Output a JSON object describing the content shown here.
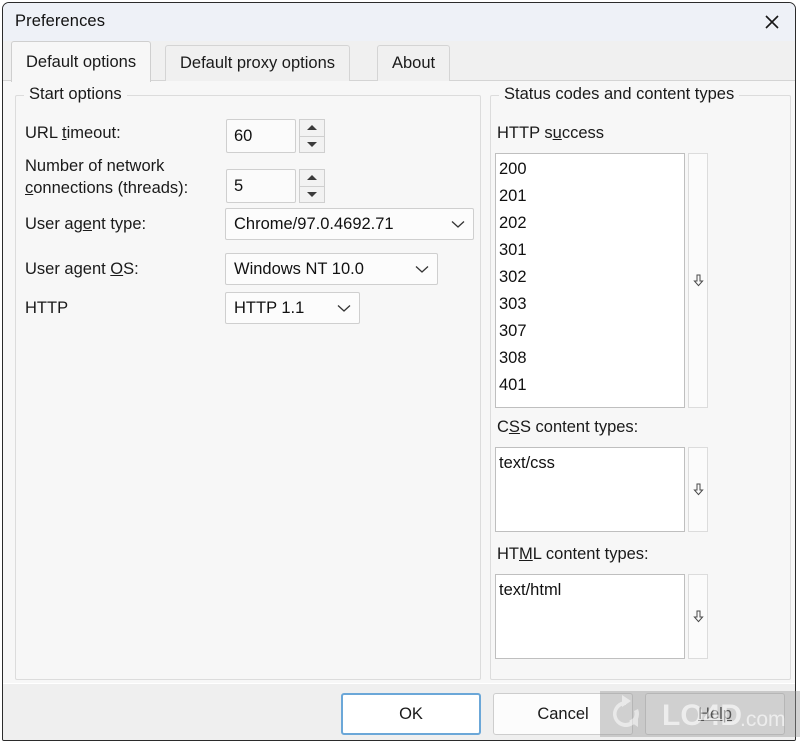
{
  "window": {
    "title": "Preferences",
    "close_icon": "close-icon"
  },
  "tabs": [
    {
      "label": "Default options",
      "selected": true
    },
    {
      "label": "Default proxy options",
      "selected": false
    },
    {
      "label": "About",
      "selected": false
    }
  ],
  "start_options": {
    "legend": "Start options",
    "rows": [
      {
        "label_pre": "URL ",
        "label_mnemonic": "t",
        "label_post": "imeout:",
        "control": "spin",
        "value": "60"
      },
      {
        "label_pre": "Number of network ",
        "label_mnemonic": "c",
        "label_post": "onnections (threads):",
        "control": "spin",
        "value": "5"
      },
      {
        "label_pre": "User ag",
        "label_mnemonic": "e",
        "label_post": "nt type:",
        "control": "combo",
        "value": "Chrome/97.0.4692.71"
      },
      {
        "label_pre": "User agent ",
        "label_mnemonic": "O",
        "label_post": "S:",
        "control": "combo",
        "value": "Windows NT 10.0"
      },
      {
        "label_pre": "HTTP",
        "label_mnemonic": "",
        "label_post": "",
        "control": "combo",
        "value": "HTTP 1.1"
      }
    ]
  },
  "status_options": {
    "legend": "Status codes and content types",
    "http_success": {
      "label_pre": "HTTP s",
      "label_mnemonic": "u",
      "label_post": "ccess",
      "items": [
        "200",
        "201",
        "202",
        "301",
        "302",
        "303",
        "307",
        "308",
        "401"
      ],
      "rail_icon": "down-arrow-icon"
    },
    "css_content_types": {
      "label_pre": "C",
      "label_mnemonic": "S",
      "label_post": "S content types:",
      "items": [
        "text/css"
      ],
      "rail_icon": "down-arrow-icon"
    },
    "html_content_types": {
      "label_pre": "HT",
      "label_mnemonic": "M",
      "label_post": "L content types:",
      "items": [
        "text/html"
      ],
      "rail_icon": "down-arrow-icon"
    }
  },
  "buttons": {
    "ok": "OK",
    "cancel": "Cancel",
    "help": "Help"
  },
  "watermark": {
    "text": "LO4D.com",
    "primary": "LO4D",
    "suffix": ".com"
  },
  "colors": {
    "titlebar": "#eef1f7",
    "dialog": "#f7f7f7",
    "buttonbar": "#efefef",
    "focus_accent": "#6ba7d8",
    "border": "#dcdcdc",
    "field_border": "#bfbfbf"
  }
}
